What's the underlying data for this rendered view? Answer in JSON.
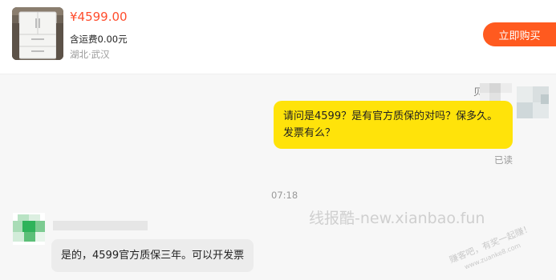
{
  "product": {
    "image": "refrigerator-thumbnail",
    "price": "¥4599.00",
    "shipping": "含运费0.00元",
    "location": "湖北·武汉",
    "buy_label": "立即购买"
  },
  "messages": {
    "right_name": "贝",
    "right_text": "请问是4599？是有官方质保的对吗？保多久。发票有么？",
    "read_status": "已读",
    "time": "07:18",
    "left_text": "是的，4599官方质保三年。可以开发票"
  },
  "watermark": {
    "text": "线报酷-new.xianbao.fun",
    "stamp_line1": "赚客吧，有奖一起赚！",
    "stamp_line2": "www.zuanke8.com"
  },
  "colors": {
    "accent": "#ff5a1f",
    "price": "#ff4d2d",
    "bubble_self": "#ffe30a",
    "bubble_other": "#ececec"
  }
}
